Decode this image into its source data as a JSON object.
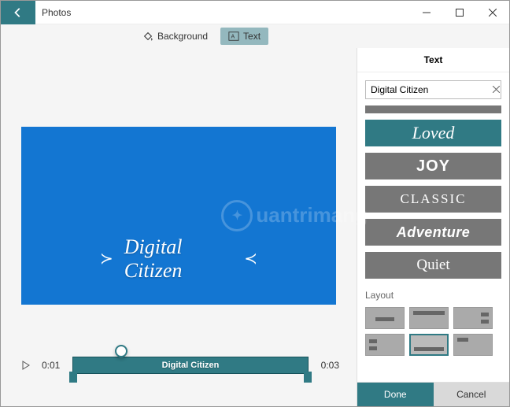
{
  "titlebar": {
    "app_title": "Photos"
  },
  "toolbar": {
    "background_label": "Background",
    "text_label": "Text"
  },
  "canvas": {
    "overlay_text": "Digital Citizen",
    "watermark": "uantrimang"
  },
  "timeline": {
    "start_time": "0:01",
    "end_time": "0:03",
    "band_label": "Digital Citizen"
  },
  "panel": {
    "header": "Text",
    "input_value": "Digital Citizen",
    "styles": {
      "loved": "Loved",
      "joy": "JOY",
      "classic": "CLASSIC",
      "adventure": "Adventure",
      "quiet": "Quiet"
    },
    "layout_label": "Layout",
    "done_label": "Done",
    "cancel_label": "Cancel"
  }
}
